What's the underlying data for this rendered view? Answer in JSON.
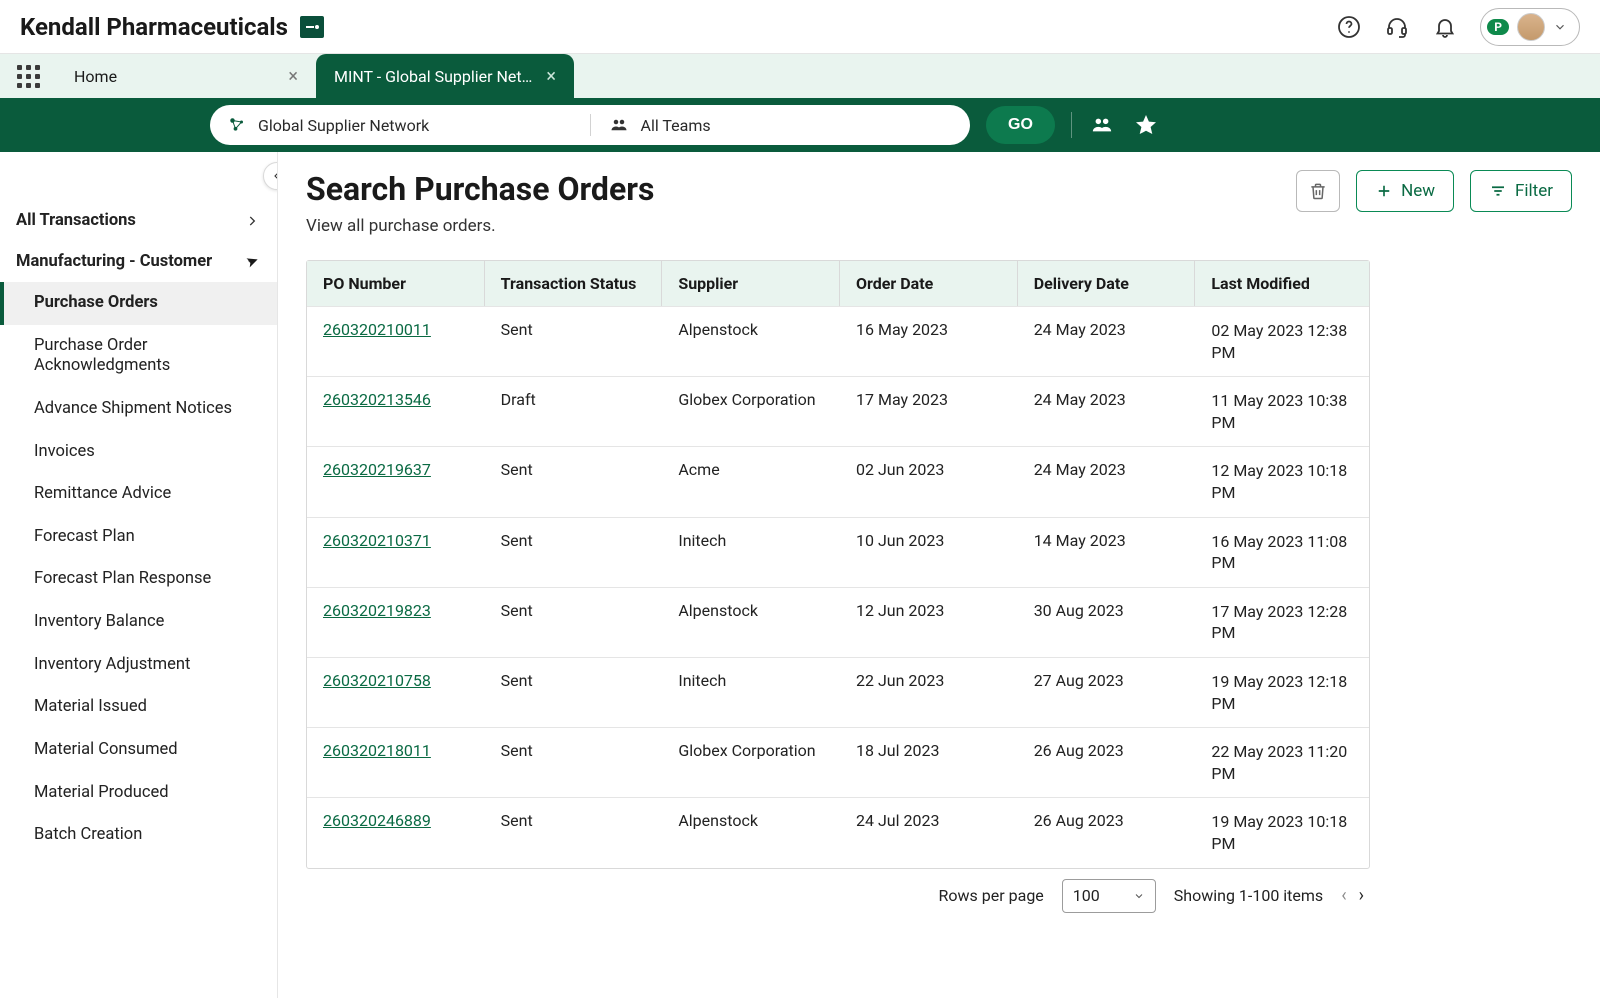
{
  "brand": "Kendall Pharmaceuticals",
  "user_badge": "P",
  "tabs": {
    "home": "Home",
    "active": "MINT - Global Supplier Net…"
  },
  "search": {
    "network": "Global Supplier Network",
    "team": "All Teams",
    "go": "GO"
  },
  "sidebar": {
    "all": "All Transactions",
    "group": "Manufacturing - Customer",
    "items": [
      "Purchase Orders",
      "Purchase Order Acknowledgments",
      "Advance Shipment Notices",
      "Invoices",
      "Remittance Advice",
      "Forecast Plan",
      "Forecast Plan Response",
      "Inventory Balance",
      "Inventory Adjustment",
      "Material Issued",
      "Material Consumed",
      "Material Produced",
      "Batch Creation"
    ]
  },
  "page": {
    "title": "Search Purchase Orders",
    "sub": "View all purchase orders.",
    "new": "New",
    "filter": "Filter"
  },
  "table": {
    "headers": [
      "PO Number",
      "Transaction Status",
      "Supplier",
      "Order Date",
      "Delivery Date",
      "Last Modified"
    ],
    "rows": [
      {
        "po": "260320210011",
        "status": "Sent",
        "supplier": "Alpenstock",
        "od": "16 May 2023",
        "dd": "24 May 2023",
        "lm": "02 May 2023 12:38 PM"
      },
      {
        "po": "260320213546",
        "status": "Draft",
        "supplier": "Globex Corporation",
        "od": "17 May 2023",
        "dd": "24 May 2023",
        "lm": "11 May 2023 10:38 PM"
      },
      {
        "po": "260320219637",
        "status": "Sent",
        "supplier": "Acme",
        "od": "02 Jun 2023",
        "dd": "24 May 2023",
        "lm": "12 May 2023 10:18 PM"
      },
      {
        "po": "260320210371",
        "status": "Sent",
        "supplier": "Initech",
        "od": "10 Jun 2023",
        "dd": "14 May 2023",
        "lm": "16 May 2023 11:08 PM"
      },
      {
        "po": "260320219823",
        "status": "Sent",
        "supplier": "Alpenstock",
        "od": "12 Jun 2023",
        "dd": "30 Aug 2023",
        "lm": "17 May 2023 12:28 PM"
      },
      {
        "po": "260320210758",
        "status": "Sent",
        "supplier": "Initech",
        "od": "22 Jun 2023",
        "dd": "27 Aug 2023",
        "lm": "19 May 2023 12:18 PM"
      },
      {
        "po": "260320218011",
        "status": "Sent",
        "supplier": "Globex Corporation",
        "od": "18 Jul 2023",
        "dd": "26 Aug 2023",
        "lm": "22 May 2023 11:20 PM"
      },
      {
        "po": "260320246889",
        "status": "Sent",
        "supplier": "Alpenstock",
        "od": "24 Jul 2023",
        "dd": "26 Aug 2023",
        "lm": "19 May 2023 10:18 PM"
      }
    ]
  },
  "pager": {
    "rpp_label": "Rows per page",
    "rpp_value": "100",
    "showing": "Showing 1-100 items"
  }
}
